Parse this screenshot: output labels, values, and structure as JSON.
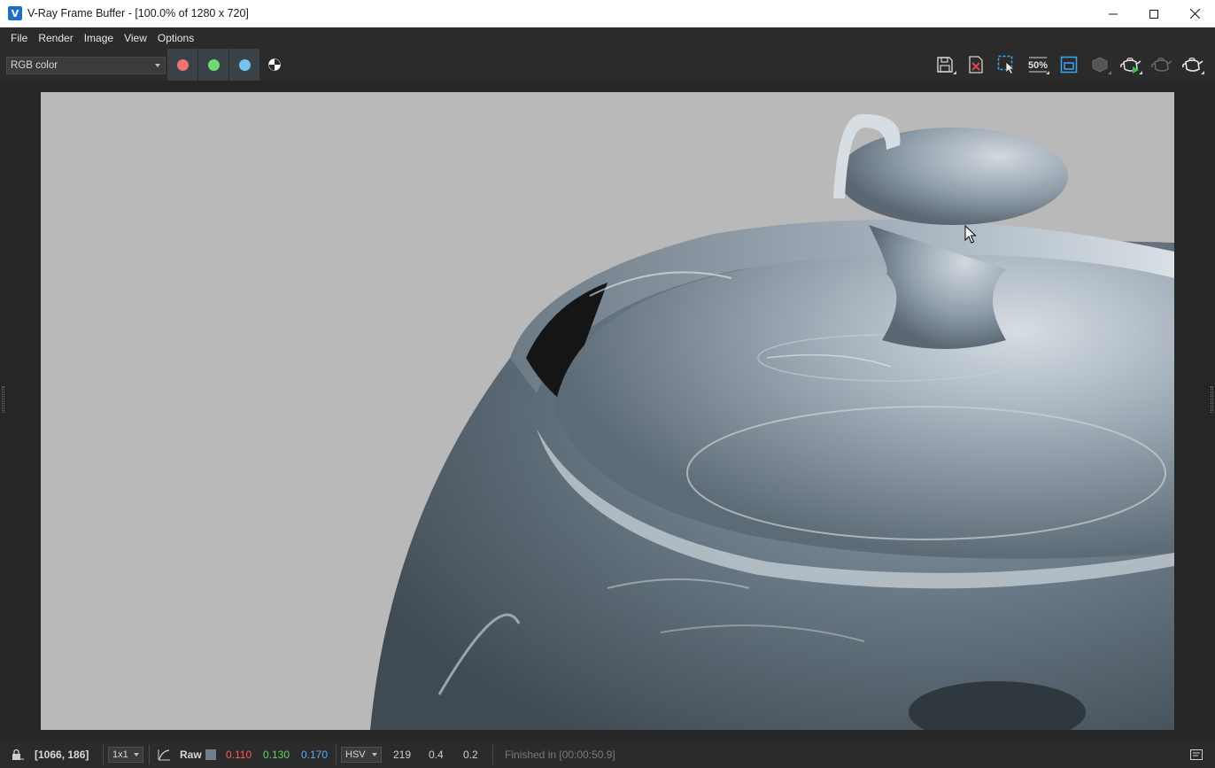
{
  "window": {
    "title": "V-Ray Frame Buffer - [100.0% of 1280 x 720]",
    "app_icon_letter": "V"
  },
  "menu": [
    "File",
    "Render",
    "Image",
    "View",
    "Options"
  ],
  "toolbar": {
    "channel_value": "RGB color",
    "channel_colors": {
      "red": "#f07272",
      "green": "#72d872",
      "blue": "#72c4f0"
    },
    "quick_zoom_label": "50%"
  },
  "status": {
    "coords": "[1066, 186]",
    "sampling": "1x1",
    "mode": "Raw",
    "swatch_color": "#6f7f8c",
    "r": "0.110",
    "g": "0.130",
    "b": "0.170",
    "color_space": "HSV",
    "h": "219",
    "s": "0.4",
    "v": "0.2",
    "message": "Finished in [00:00:50.9]"
  },
  "colors": {
    "red_text": "#ff5a5a",
    "green_text": "#5fd45f",
    "blue_text": "#5aaaf0"
  }
}
